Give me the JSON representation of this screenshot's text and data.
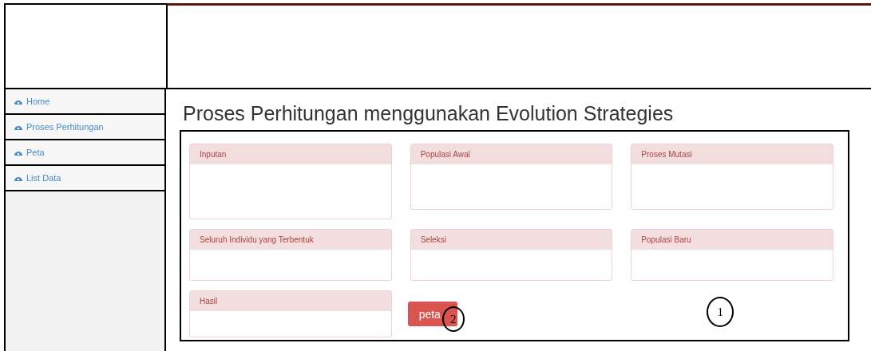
{
  "sidebar": {
    "items": [
      {
        "label": "Home"
      },
      {
        "label": "Proses Perhitungan"
      },
      {
        "label": "Peta"
      },
      {
        "label": "List Data"
      }
    ]
  },
  "page_title": "Proses Perhitungan menggunakan Evolution Strategies",
  "panels": [
    {
      "title": "Inputan"
    },
    {
      "title": "Populasi Awal"
    },
    {
      "title": "Proses Mutasi"
    },
    {
      "title": "Seluruh Individu yang Terbentuk"
    },
    {
      "title": "Seleksi"
    },
    {
      "title": "Populasi Baru"
    },
    {
      "title": "Hasil"
    }
  ],
  "button": {
    "label": "peta"
  },
  "annotations": [
    {
      "label": "1"
    },
    {
      "label": "2"
    }
  ]
}
